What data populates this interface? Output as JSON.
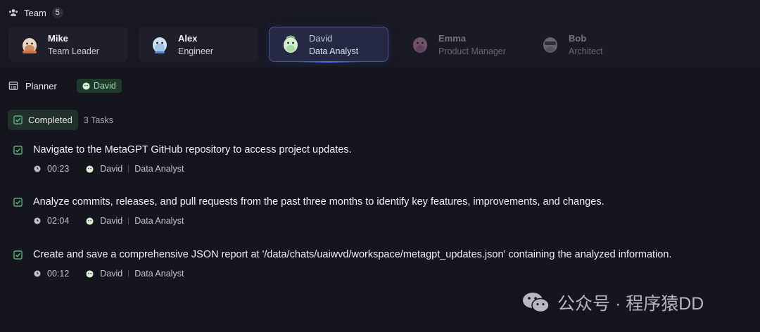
{
  "team": {
    "label": "Team",
    "count": "5",
    "members": [
      {
        "name": "Mike",
        "role": "Team Leader"
      },
      {
        "name": "Alex",
        "role": "Engineer"
      },
      {
        "name": "David",
        "role": "Data Analyst"
      },
      {
        "name": "Emma",
        "role": "Product Manager"
      },
      {
        "name": "Bob",
        "role": "Architect"
      }
    ],
    "active_member": "David"
  },
  "planner": {
    "label": "Planner",
    "assignee": "David"
  },
  "status": {
    "label": "Completed",
    "tasks_count": "3 Tasks"
  },
  "tasks": [
    {
      "title": "Navigate to the MetaGPT GitHub repository to access project updates.",
      "time": "00:23",
      "assignee": "David",
      "role": "Data Analyst"
    },
    {
      "title": "Analyze commits, releases, and pull requests from the past three months to identify key features, improvements, and changes.",
      "time": "02:04",
      "assignee": "David",
      "role": "Data Analyst"
    },
    {
      "title": "Create and save a comprehensive JSON report at '/data/chats/uaiwvd/workspace/metagpt_updates.json' containing the analyzed information.",
      "time": "00:12",
      "assignee": "David",
      "role": "Data Analyst"
    }
  ],
  "watermark": {
    "text": "公众号 · 程序猿DD"
  },
  "colors": {
    "background": "#14151d",
    "active_border": "#4b5590",
    "success_green": "#5fbf7f",
    "chip_bg": "#1f3a2c"
  },
  "icons": {
    "team": "team-icon",
    "planner": "planner-icon",
    "check": "checkbox-checked-icon",
    "clock": "clock-icon",
    "watermark": "wechat-icon"
  }
}
